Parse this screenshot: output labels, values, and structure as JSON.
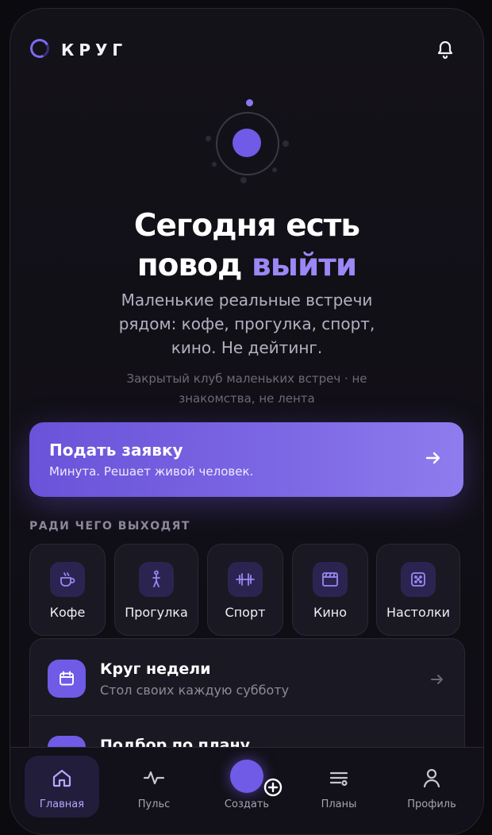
{
  "app": {
    "name": "КРУГ"
  },
  "hero": {
    "headline_line1": "Сегодня есть",
    "headline_line2_plain": "повод",
    "headline_line2_accent": "выйти",
    "subtitle": "Маленькие реальные встречи рядом: кофе, прогулка, спорт, кино. Не дейтинг.",
    "note": "Закрытый клуб маленьких встреч · не знакомства, не лента"
  },
  "cta": {
    "title": "Подать заявку",
    "subtitle": "Минута. Решает живой человек."
  },
  "section": {
    "label": "РАДИ ЧЕГО ВЫХОДЯТ"
  },
  "categories": [
    {
      "label": "Кофе",
      "icon": "coffee-cup-icon"
    },
    {
      "label": "Прогулка",
      "icon": "walking-person-icon"
    },
    {
      "label": "Спорт",
      "icon": "dumbbell-icon"
    },
    {
      "label": "Кино",
      "icon": "film-icon"
    },
    {
      "label": "Настолки",
      "icon": "dice-icon"
    }
  ],
  "list": [
    {
      "title": "Круг недели",
      "subtitle": "Стол своих каждую субботу",
      "icon": "calendar-icon"
    },
    {
      "title": "Подбор по плану",
      "subtitle": "",
      "icon": "plan-icon"
    }
  ],
  "tabs": [
    {
      "label": "Главная",
      "icon": "home-icon",
      "active": true
    },
    {
      "label": "Пульс",
      "icon": "pulse-icon"
    },
    {
      "label": "Создать",
      "icon": "plus-icon"
    },
    {
      "label": "Планы",
      "icon": "list-icon"
    },
    {
      "label": "Профиль",
      "icon": "profile-icon"
    }
  ],
  "colors": {
    "accent": "#6f5be6",
    "accent_light": "#9b87f5",
    "background": "#111017"
  }
}
